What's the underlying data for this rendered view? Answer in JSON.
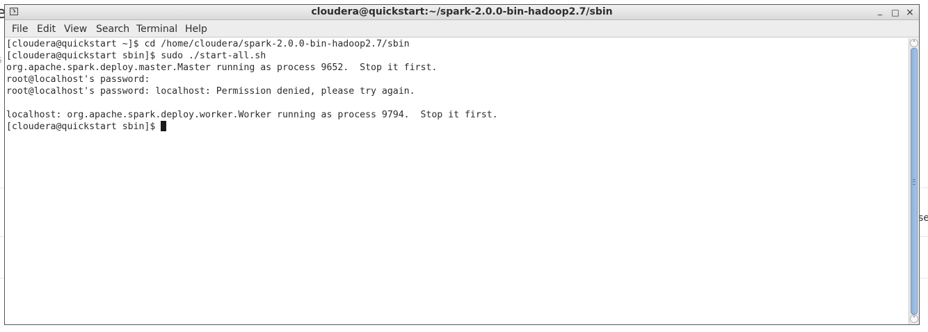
{
  "window": {
    "title": "cloudera@quickstart:~/spark-2.0.0-bin-hadoop2.7/sbin",
    "minimize_glyph": "_",
    "maximize_glyph": "□",
    "close_glyph": "×"
  },
  "menu": {
    "items": [
      {
        "label": "File"
      },
      {
        "label": "Edit"
      },
      {
        "label": "View"
      },
      {
        "label": "Search"
      },
      {
        "label": "Terminal"
      },
      {
        "label": "Help"
      }
    ]
  },
  "terminal": {
    "lines": [
      "[cloudera@quickstart ~]$ cd /home/cloudera/spark-2.0.0-bin-hadoop2.7/sbin",
      "[cloudera@quickstart sbin]$ sudo ./start-all.sh",
      "org.apache.spark.deploy.master.Master running as process 9652.  Stop it first.",
      "root@localhost's password: ",
      "root@localhost's password: localhost: Permission denied, please try again.",
      "",
      "localhost: org.apache.spark.deploy.worker.Worker running as process 9794.  Stop it first.",
      "[cloudera@quickstart sbin]$ "
    ]
  },
  "background": {
    "fragment_left_top": "e",
    "fragment_left_mid": "6",
    "fragment_right": "se"
  },
  "icons": {
    "window_icon": "terminal-icon",
    "scroll_up": "chevron-up-icon",
    "scroll_down": "chevron-down-icon"
  },
  "colors": {
    "scroll_thumb": "#9bb9e0",
    "terminal_bg": "#ffffff",
    "terminal_fg": "#2b2b2b"
  }
}
